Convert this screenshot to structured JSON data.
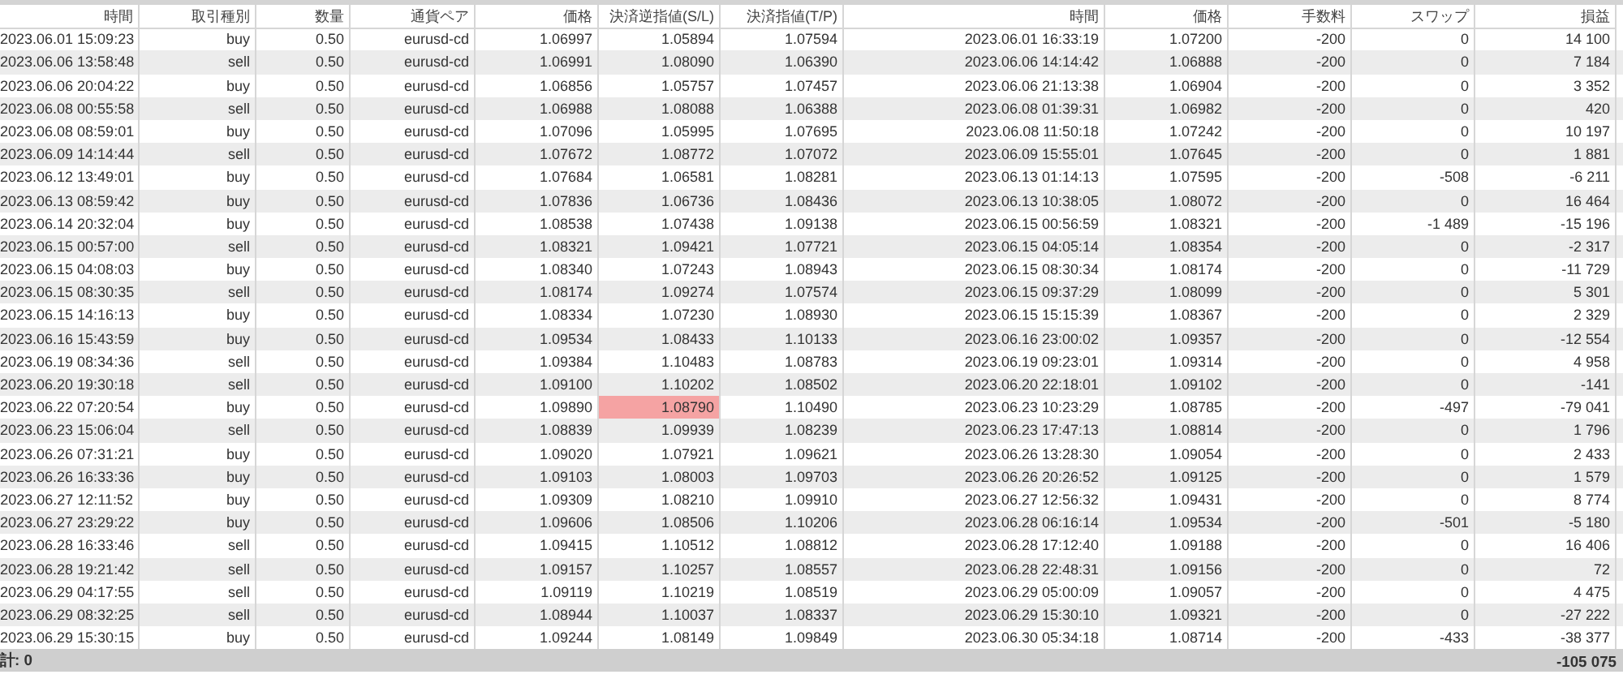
{
  "table": {
    "columns": [
      "時間",
      "取引種別",
      "数量",
      "通貨ペア",
      "価格",
      "決済逆指値(S/L)",
      "決済指値(T/P)",
      "時間",
      "価格",
      "手数料",
      "スワップ",
      "損益"
    ],
    "rows": [
      {
        "cells": [
          "2023.06.01 15:09:23",
          "buy",
          "0.50",
          "eurusd-cd",
          "1.06997",
          "1.05894",
          "1.07594",
          "2023.06.01 16:33:19",
          "1.07200",
          "-200",
          "0",
          "14 100"
        ],
        "sl_highlight": false
      },
      {
        "cells": [
          "2023.06.06 13:58:48",
          "sell",
          "0.50",
          "eurusd-cd",
          "1.06991",
          "1.08090",
          "1.06390",
          "2023.06.06 14:14:42",
          "1.06888",
          "-200",
          "0",
          "7 184"
        ],
        "sl_highlight": false
      },
      {
        "cells": [
          "2023.06.06 20:04:22",
          "buy",
          "0.50",
          "eurusd-cd",
          "1.06856",
          "1.05757",
          "1.07457",
          "2023.06.06 21:13:38",
          "1.06904",
          "-200",
          "0",
          "3 352"
        ],
        "sl_highlight": false
      },
      {
        "cells": [
          "2023.06.08 00:55:58",
          "sell",
          "0.50",
          "eurusd-cd",
          "1.06988",
          "1.08088",
          "1.06388",
          "2023.06.08 01:39:31",
          "1.06982",
          "-200",
          "0",
          "420"
        ],
        "sl_highlight": false
      },
      {
        "cells": [
          "2023.06.08 08:59:01",
          "buy",
          "0.50",
          "eurusd-cd",
          "1.07096",
          "1.05995",
          "1.07695",
          "2023.06.08 11:50:18",
          "1.07242",
          "-200",
          "0",
          "10 197"
        ],
        "sl_highlight": false
      },
      {
        "cells": [
          "2023.06.09 14:14:44",
          "sell",
          "0.50",
          "eurusd-cd",
          "1.07672",
          "1.08772",
          "1.07072",
          "2023.06.09 15:55:01",
          "1.07645",
          "-200",
          "0",
          "1 881"
        ],
        "sl_highlight": false
      },
      {
        "cells": [
          "2023.06.12 13:49:01",
          "buy",
          "0.50",
          "eurusd-cd",
          "1.07684",
          "1.06581",
          "1.08281",
          "2023.06.13 01:14:13",
          "1.07595",
          "-200",
          "-508",
          "-6 211"
        ],
        "sl_highlight": false
      },
      {
        "cells": [
          "2023.06.13 08:59:42",
          "buy",
          "0.50",
          "eurusd-cd",
          "1.07836",
          "1.06736",
          "1.08436",
          "2023.06.13 10:38:05",
          "1.08072",
          "-200",
          "0",
          "16 464"
        ],
        "sl_highlight": false
      },
      {
        "cells": [
          "2023.06.14 20:32:04",
          "buy",
          "0.50",
          "eurusd-cd",
          "1.08538",
          "1.07438",
          "1.09138",
          "2023.06.15 00:56:59",
          "1.08321",
          "-200",
          "-1 489",
          "-15 196"
        ],
        "sl_highlight": false
      },
      {
        "cells": [
          "2023.06.15 00:57:00",
          "sell",
          "0.50",
          "eurusd-cd",
          "1.08321",
          "1.09421",
          "1.07721",
          "2023.06.15 04:05:14",
          "1.08354",
          "-200",
          "0",
          "-2 317"
        ],
        "sl_highlight": false
      },
      {
        "cells": [
          "2023.06.15 04:08:03",
          "buy",
          "0.50",
          "eurusd-cd",
          "1.08340",
          "1.07243",
          "1.08943",
          "2023.06.15 08:30:34",
          "1.08174",
          "-200",
          "0",
          "-11 729"
        ],
        "sl_highlight": false
      },
      {
        "cells": [
          "2023.06.15 08:30:35",
          "sell",
          "0.50",
          "eurusd-cd",
          "1.08174",
          "1.09274",
          "1.07574",
          "2023.06.15 09:37:29",
          "1.08099",
          "-200",
          "0",
          "5 301"
        ],
        "sl_highlight": false
      },
      {
        "cells": [
          "2023.06.15 14:16:13",
          "buy",
          "0.50",
          "eurusd-cd",
          "1.08334",
          "1.07230",
          "1.08930",
          "2023.06.15 15:15:39",
          "1.08367",
          "-200",
          "0",
          "2 329"
        ],
        "sl_highlight": false
      },
      {
        "cells": [
          "2023.06.16 15:43:59",
          "buy",
          "0.50",
          "eurusd-cd",
          "1.09534",
          "1.08433",
          "1.10133",
          "2023.06.16 23:00:02",
          "1.09357",
          "-200",
          "0",
          "-12 554"
        ],
        "sl_highlight": false
      },
      {
        "cells": [
          "2023.06.19 08:34:36",
          "sell",
          "0.50",
          "eurusd-cd",
          "1.09384",
          "1.10483",
          "1.08783",
          "2023.06.19 09:23:01",
          "1.09314",
          "-200",
          "0",
          "4 958"
        ],
        "sl_highlight": false
      },
      {
        "cells": [
          "2023.06.20 19:30:18",
          "sell",
          "0.50",
          "eurusd-cd",
          "1.09100",
          "1.10202",
          "1.08502",
          "2023.06.20 22:18:01",
          "1.09102",
          "-200",
          "0",
          "-141"
        ],
        "sl_highlight": false
      },
      {
        "cells": [
          "2023.06.22 07:20:54",
          "buy",
          "0.50",
          "eurusd-cd",
          "1.09890",
          "1.08790",
          "1.10490",
          "2023.06.23 10:23:29",
          "1.08785",
          "-200",
          "-497",
          "-79 041"
        ],
        "sl_highlight": true
      },
      {
        "cells": [
          "2023.06.23 15:06:04",
          "sell",
          "0.50",
          "eurusd-cd",
          "1.08839",
          "1.09939",
          "1.08239",
          "2023.06.23 17:47:13",
          "1.08814",
          "-200",
          "0",
          "1 796"
        ],
        "sl_highlight": false
      },
      {
        "cells": [
          "2023.06.26 07:31:21",
          "buy",
          "0.50",
          "eurusd-cd",
          "1.09020",
          "1.07921",
          "1.09621",
          "2023.06.26 13:28:30",
          "1.09054",
          "-200",
          "0",
          "2 433"
        ],
        "sl_highlight": false
      },
      {
        "cells": [
          "2023.06.26 16:33:36",
          "buy",
          "0.50",
          "eurusd-cd",
          "1.09103",
          "1.08003",
          "1.09703",
          "2023.06.26 20:26:52",
          "1.09125",
          "-200",
          "0",
          "1 579"
        ],
        "sl_highlight": false
      },
      {
        "cells": [
          "2023.06.27 12:11:52",
          "buy",
          "0.50",
          "eurusd-cd",
          "1.09309",
          "1.08210",
          "1.09910",
          "2023.06.27 12:56:32",
          "1.09431",
          "-200",
          "0",
          "8 774"
        ],
        "sl_highlight": false
      },
      {
        "cells": [
          "2023.06.27 23:29:22",
          "buy",
          "0.50",
          "eurusd-cd",
          "1.09606",
          "1.08506",
          "1.10206",
          "2023.06.28 06:16:14",
          "1.09534",
          "-200",
          "-501",
          "-5 180"
        ],
        "sl_highlight": false
      },
      {
        "cells": [
          "2023.06.28 16:33:46",
          "sell",
          "0.50",
          "eurusd-cd",
          "1.09415",
          "1.10512",
          "1.08812",
          "2023.06.28 17:12:40",
          "1.09188",
          "-200",
          "0",
          "16 406"
        ],
        "sl_highlight": false
      },
      {
        "cells": [
          "2023.06.28 19:21:42",
          "sell",
          "0.50",
          "eurusd-cd",
          "1.09157",
          "1.10257",
          "1.08557",
          "2023.06.28 22:48:31",
          "1.09156",
          "-200",
          "0",
          "72"
        ],
        "sl_highlight": false
      },
      {
        "cells": [
          "2023.06.29 04:17:55",
          "sell",
          "0.50",
          "eurusd-cd",
          "1.09119",
          "1.10219",
          "1.08519",
          "2023.06.29 05:00:09",
          "1.09057",
          "-200",
          "0",
          "4 475"
        ],
        "sl_highlight": false
      },
      {
        "cells": [
          "2023.06.29 08:32:25",
          "sell",
          "0.50",
          "eurusd-cd",
          "1.08944",
          "1.10037",
          "1.08337",
          "2023.06.29 15:30:10",
          "1.09321",
          "-200",
          "0",
          "-27 222"
        ],
        "sl_highlight": false
      },
      {
        "cells": [
          "2023.06.29 15:30:15",
          "buy",
          "0.50",
          "eurusd-cd",
          "1.09244",
          "1.08149",
          "1.09849",
          "2023.06.30 05:34:18",
          "1.08714",
          "-200",
          "-433",
          "-38 377"
        ],
        "sl_highlight": false
      }
    ],
    "footer": {
      "label": "計: 0",
      "total": "-105 075"
    }
  }
}
